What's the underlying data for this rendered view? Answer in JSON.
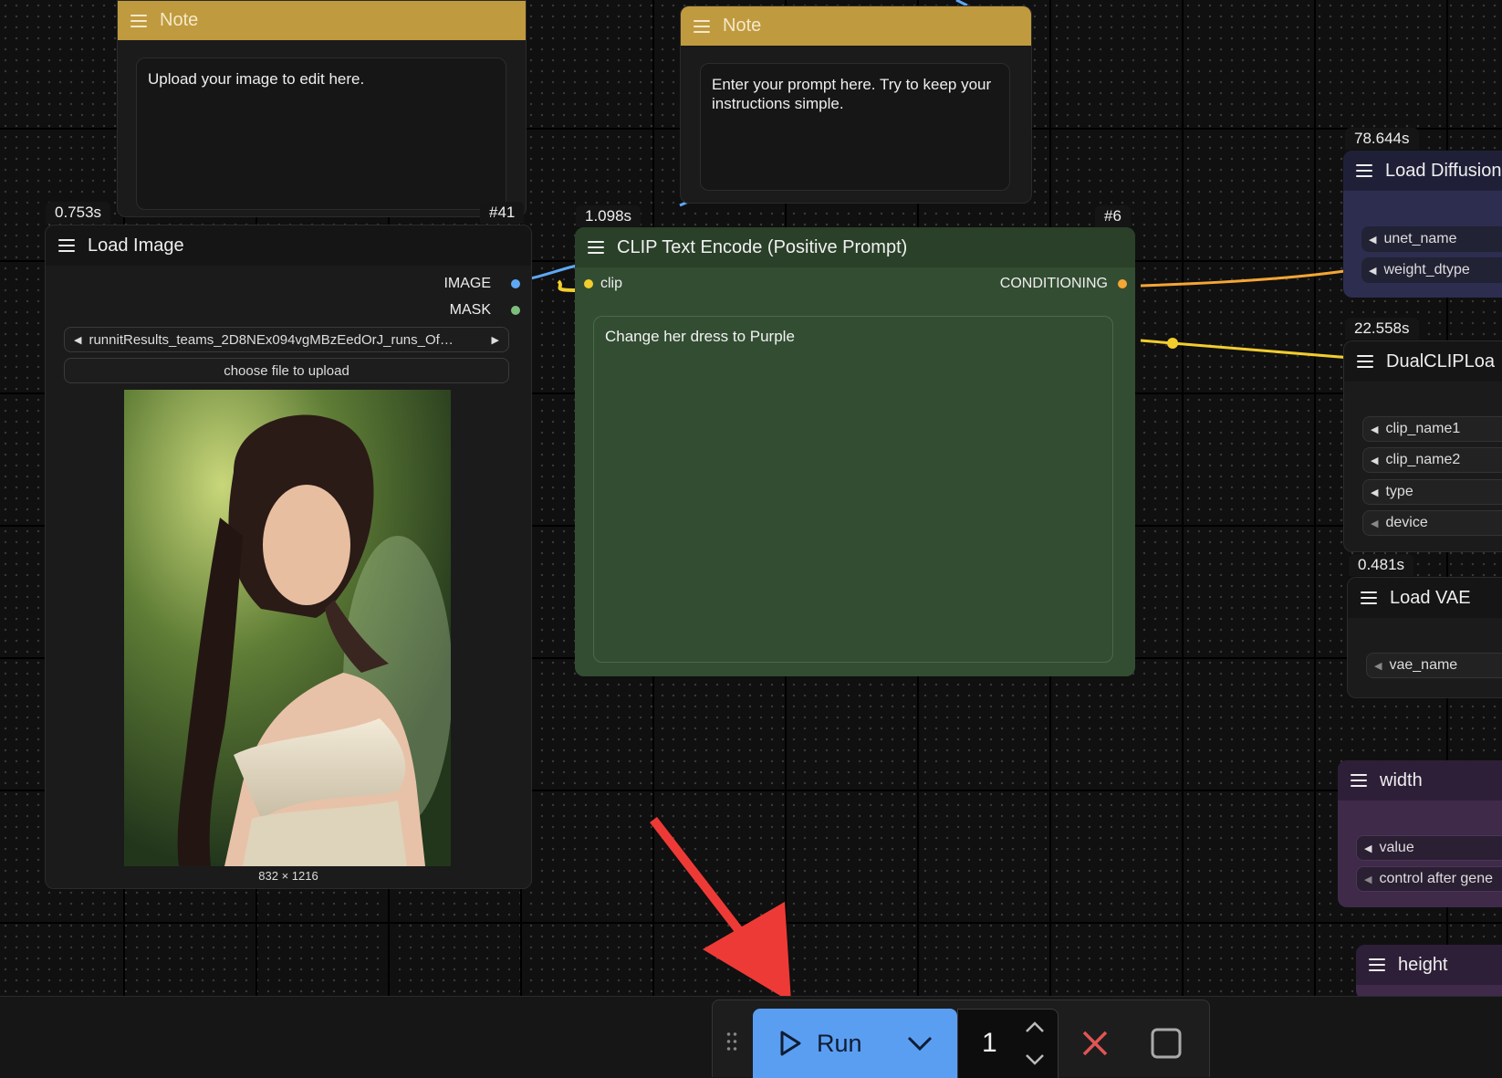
{
  "note_left": {
    "title": "Note",
    "text": "Upload your image to edit here.",
    "id_badge": "#41"
  },
  "note_right": {
    "title": "Note",
    "text": "Enter your prompt here.  Try to keep your instructions simple."
  },
  "load_image": {
    "time": "0.753s",
    "title": "Load Image",
    "outputs": [
      "IMAGE",
      "MASK"
    ],
    "file_name": "runnitResults_teams_2D8NEx094vgMBzEedOrJ_runs_Of…",
    "upload_label": "choose file to upload",
    "image_size": "832 × 1216"
  },
  "clip_encode": {
    "time": "1.098s",
    "id_badge": "#6",
    "title": "CLIP Text Encode (Positive Prompt)",
    "input": "clip",
    "output": "CONDITIONING",
    "prompt": "Change her dress to Purple"
  },
  "right_nodes": {
    "diffusion": {
      "time": "78.644s",
      "title": "Load Diffusion",
      "widgets": [
        "unet_name",
        "weight_dtype"
      ]
    },
    "dualclip": {
      "time": "22.558s",
      "title": "DualCLIPLoa",
      "widgets": [
        "clip_name1",
        "clip_name2",
        "type",
        "device"
      ]
    },
    "vae": {
      "time": "0.481s",
      "title": "Load VAE",
      "widgets": [
        "vae_name"
      ]
    },
    "width": {
      "title": "width",
      "widgets": [
        "value",
        "control after gene"
      ]
    },
    "height": {
      "title": "height"
    }
  },
  "toolbar": {
    "run_label": "Run",
    "batch_count": "1"
  },
  "colors": {
    "note_header": "#c09a3e",
    "clip_node_bg": "#334d33",
    "diffusion_body": "#2c2d4f",
    "width_body": "#3f2a4a",
    "run_button": "#5a9ef2",
    "cancel": "#e05555",
    "image_port": "#5fa8f5",
    "mask_port": "#7cbf7c",
    "clip_port": "#f2cd2e",
    "conditioning_port": "#f5a634"
  }
}
